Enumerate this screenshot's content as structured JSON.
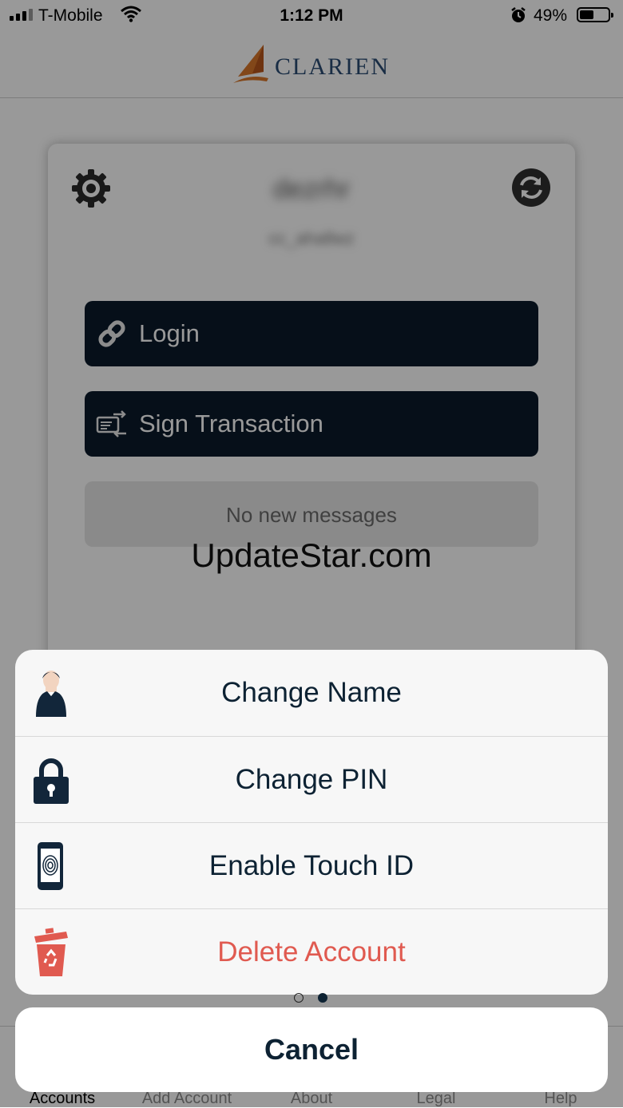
{
  "status_bar": {
    "carrier": "T-Mobile",
    "time": "1:12 PM",
    "battery_percent": "49%",
    "battery_level": 0.49
  },
  "header": {
    "logo_text": "CLARIEN"
  },
  "card": {
    "account_name": "dezrhr",
    "account_username": "cc_ahallwz",
    "login_label": "Login",
    "sign_label": "Sign Transaction",
    "messages": "No new messages"
  },
  "watermark": "UpdateStar.com",
  "tabs": [
    {
      "label": "Accounts",
      "active": true
    },
    {
      "label": "Add Account"
    },
    {
      "label": "About"
    },
    {
      "label": "Legal"
    },
    {
      "label": "Help"
    }
  ],
  "action_sheet": {
    "items": [
      {
        "label": "Change Name",
        "icon": "person-icon"
      },
      {
        "label": "Change PIN",
        "icon": "lock-icon"
      },
      {
        "label": "Enable Touch ID",
        "icon": "fingerprint-phone-icon"
      },
      {
        "label": "Delete Account",
        "icon": "trash-icon",
        "color": "#e05a50"
      }
    ],
    "cancel_label": "Cancel"
  },
  "page_indicator": {
    "pages": 2,
    "current": 2
  },
  "colors": {
    "button_bg": "#0b1a2b",
    "accent_text": "#0d2233",
    "destructive": "#e05a50",
    "logo_blue": "#2b4c73",
    "logo_orange": "#d9772b"
  }
}
